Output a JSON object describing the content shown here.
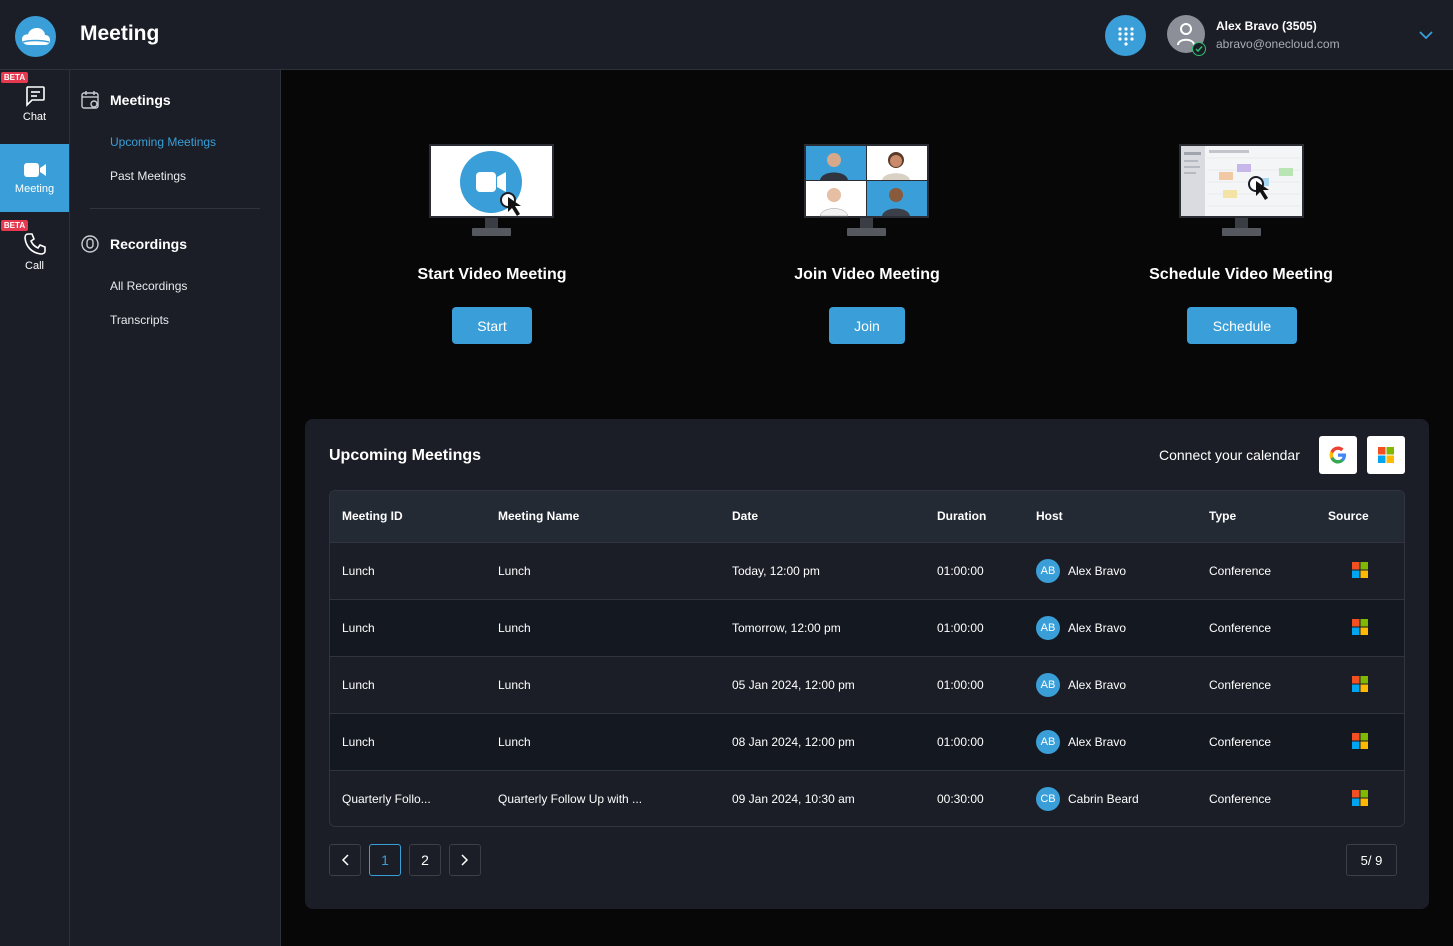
{
  "header": {
    "title": "Meeting",
    "user_name": "Alex Bravo (3505)",
    "user_email": "abravo@onecloud.com",
    "brand_color": "#3a9fd8"
  },
  "rail": {
    "items": [
      {
        "label": "Chat",
        "badge": "BETA"
      },
      {
        "label": "Meeting"
      },
      {
        "label": "Call",
        "badge": "BETA"
      }
    ]
  },
  "subnav": {
    "meetings_heading": "Meetings",
    "meetings_links": [
      "Upcoming Meetings",
      "Past Meetings"
    ],
    "recordings_heading": "Recordings",
    "recordings_links": [
      "All Recordings",
      "Transcripts"
    ]
  },
  "actions": [
    {
      "title": "Start Video Meeting",
      "button": "Start"
    },
    {
      "title": "Join Video Meeting",
      "button": "Join"
    },
    {
      "title": "Schedule Video Meeting",
      "button": "Schedule"
    }
  ],
  "upcoming": {
    "title": "Upcoming Meetings",
    "connect_text": "Connect your calendar",
    "columns": [
      "Meeting ID",
      "Meeting Name",
      "Date",
      "Duration",
      "Host",
      "Type",
      "Source"
    ],
    "rows": [
      {
        "id": "Lunch",
        "name": "Lunch",
        "date": "Today, 12:00 pm",
        "duration": "01:00:00",
        "initials": "AB",
        "host": "Alex Bravo",
        "type": "Conference",
        "source": "microsoft-icon"
      },
      {
        "id": "Lunch",
        "name": "Lunch",
        "date": "Tomorrow, 12:00 pm",
        "duration": "01:00:00",
        "initials": "AB",
        "host": "Alex Bravo",
        "type": "Conference",
        "source": "microsoft-icon"
      },
      {
        "id": "Lunch",
        "name": "Lunch",
        "date": "05 Jan 2024, 12:00 pm",
        "duration": "01:00:00",
        "initials": "AB",
        "host": "Alex Bravo",
        "type": "Conference",
        "source": "microsoft-icon"
      },
      {
        "id": "Lunch",
        "name": "Lunch",
        "date": "08 Jan 2024, 12:00 pm",
        "duration": "01:00:00",
        "initials": "AB",
        "host": "Alex Bravo",
        "type": "Conference",
        "source": "microsoft-icon"
      },
      {
        "id": "Quarterly Follo...",
        "name": "Quarterly Follow Up with ...",
        "date": "09 Jan 2024, 10:30 am",
        "duration": "00:30:00",
        "initials": "CB",
        "host": "Cabrin Beard",
        "type": "Conference",
        "source": "microsoft-icon"
      }
    ],
    "pagination": {
      "pages": [
        "1",
        "2"
      ],
      "current": "1",
      "count": "5/ 9"
    }
  }
}
